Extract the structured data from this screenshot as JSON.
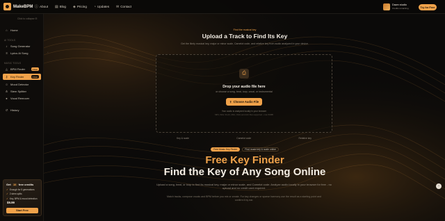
{
  "app": {
    "name": "MakeBPM"
  },
  "nav": [
    {
      "label": "About",
      "icon": "info-icon"
    },
    {
      "label": "Blog",
      "icon": "book-icon"
    },
    {
      "label": "Pricing",
      "icon": "price-tag-icon"
    },
    {
      "label": "Updates",
      "icon": "bell-icon"
    },
    {
      "label": "Contact",
      "icon": "mail-icon"
    }
  ],
  "user": {
    "name": "Dawn studio",
    "plan": "Credits remaining",
    "cta": "Try for Free"
  },
  "sidebar": {
    "collapse_label": "Click to collapse",
    "items": [
      {
        "label": "Home",
        "icon": "home-icon",
        "section": ""
      },
      {
        "label": "Song Generator",
        "icon": "music-icon",
        "section": "AI TOOLS"
      },
      {
        "label": "Lyrics AI Song",
        "icon": "lyrics-icon",
        "section": ""
      },
      {
        "label": "BPM Finder",
        "icon": "metronome-icon",
        "section": "MUSIC TOOLS",
        "badge": "FREE"
      },
      {
        "label": "Key Finder",
        "icon": "key-icon",
        "section": "",
        "badge": "FREE",
        "active": true
      },
      {
        "label": "Mood Detector",
        "icon": "mood-icon",
        "section": ""
      },
      {
        "label": "Stem Splitter",
        "icon": "split-icon",
        "section": ""
      },
      {
        "label": "Vocal Remover",
        "icon": "mic-icon",
        "section": ""
      },
      {
        "label": "History",
        "icon": "history-icon",
        "section": ""
      }
    ],
    "section_ai": "AI TOOLS",
    "section_music": "MUSIC TOOLS"
  },
  "promo": {
    "title": "Get",
    "pill": "10",
    "title_rest": "free credits",
    "lines": [
      "Enough for 5 generations",
      "2 stem splits",
      "Key, BPM & mood detection"
    ],
    "price": "$9.99",
    "button": "Start Free"
  },
  "main": {
    "eyebrow": "Find the musical key",
    "title": "Upload a Track to Find Its Key",
    "subtitle": "Get the likely musical key, major or minor scale, Camelot code, and relative key from audio analyzed in your device.",
    "upload": {
      "title": "Drop your audio file here",
      "subtitle": "or choose a song, beat, loop, vocal, or instrumental",
      "button": "Choose Audio File",
      "note": "Your audio is analyzed locally in your browser",
      "formats": "MP3, WAV, FLAC, M4A, OGG and AAC files supported - max 50MB"
    },
    "features": [
      "Key & scale",
      "Camelot code",
      "Relative key"
    ],
    "chips": [
      "Free Music Key Finder",
      "Find music key & scale online"
    ],
    "hero_line1": "Free Key Finder",
    "hero_line2": "Find the Key of Any Song Online",
    "description": "Upload a song, beat, or loop to find its musical key, major or minor scale, and Camelot code. Analyze audio locally in your browser for free - no upload and no credit card required.",
    "description2": "Match tracks, compose vocals and BPM before you mix or create. For key changes or sparse harmony use the result as a starting point and confirm it by ear."
  },
  "colors": {
    "accent": "#f0a24a",
    "background": "#0b0a09",
    "text": "#f3ede4"
  }
}
